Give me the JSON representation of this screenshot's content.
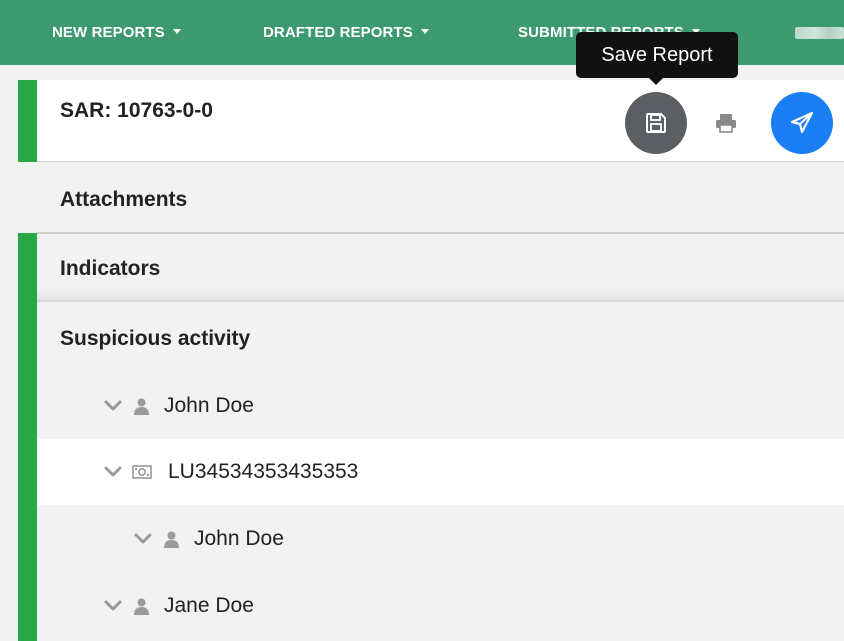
{
  "nav": {
    "items": [
      {
        "label": "NEW REPORTS"
      },
      {
        "label": "DRAFTED REPORTS"
      },
      {
        "label": "SUBMITTED REPORTS"
      }
    ]
  },
  "tooltip": {
    "text": "Save Report"
  },
  "report": {
    "title": "SAR: 10763-0-0"
  },
  "sections": {
    "attachments": "Attachments",
    "indicators": "Indicators",
    "suspicious_activity": "Suspicious activity"
  },
  "tree": [
    {
      "icon": "user-icon",
      "label": "John Doe",
      "level": 0
    },
    {
      "icon": "money-icon",
      "label": "LU34534353435353",
      "level": 0,
      "selected": true
    },
    {
      "icon": "user-icon",
      "label": "John Doe",
      "level": 1
    },
    {
      "icon": "user-icon",
      "label": "Jane Doe",
      "level": 0
    }
  ],
  "colors": {
    "nav_bg": "#3d9a6e",
    "accent_green": "#27a844",
    "save_button": "#5b5f63",
    "send_button": "#1a7ef5"
  }
}
